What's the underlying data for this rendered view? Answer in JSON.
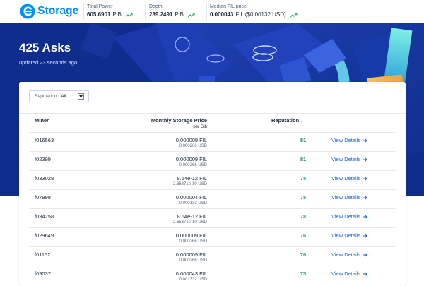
{
  "brand": {
    "name": "Storage",
    "color": "#0090ff"
  },
  "stats": [
    {
      "label": "Total Power",
      "value": "605.6901",
      "unit": "PiB"
    },
    {
      "label": "Depth",
      "value": "289.2491",
      "unit": "PiB"
    },
    {
      "label": "Median FIL price",
      "value": "0.000043",
      "unit": "FIL ($0.00132 USD)"
    }
  ],
  "hero": {
    "title": "425 Asks",
    "subtitle": "updated  23  seconds ago"
  },
  "filter": {
    "label": "Reputation:",
    "value": "All"
  },
  "table": {
    "col_miner": "Miner",
    "col_price": "Monthly Storage Price",
    "col_price_unit": "per Gib",
    "col_reputation": "Reputation ↓",
    "details_label": "View Details",
    "rows": [
      {
        "miner": "f016563",
        "fil": "0.000009 FIL",
        "usd": "0.000266 USD",
        "reputation": "81"
      },
      {
        "miner": "f02399",
        "fil": "0.000009 FIL",
        "usd": "0.000266 USD",
        "reputation": "81"
      },
      {
        "miner": "f033028",
        "fil": "8.64e-12 FIL",
        "usd": "2.66371e-10 USD",
        "reputation": "78"
      },
      {
        "miner": "f07998",
        "fil": "0.000004 FIL",
        "usd": "0.000133 USD",
        "reputation": "78"
      },
      {
        "miner": "f034258",
        "fil": "8.64e-12 FIL",
        "usd": "2.66371e-10 USD",
        "reputation": "78"
      },
      {
        "miner": "f029649",
        "fil": "0.000009 FIL",
        "usd": "0.000266 USD",
        "reputation": "76"
      },
      {
        "miner": "f01152",
        "fil": "0.000009 FIL",
        "usd": "0.000266 USD",
        "reputation": "76"
      },
      {
        "miner": "f09037",
        "fil": "0.000043 FIL",
        "usd": "0.001332 USD",
        "reputation": "75"
      }
    ]
  },
  "colors": {
    "hero_bg": "#0f2d8c",
    "link": "#1a66d6",
    "reputation_high": "#1a7f4e",
    "reputation_mid": "#2bb07a"
  }
}
